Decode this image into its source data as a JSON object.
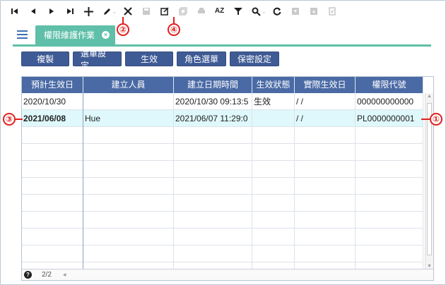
{
  "toolbar": {
    "icons": [
      "first-page-icon",
      "prev-icon",
      "next-icon",
      "last-page-icon",
      "add-icon",
      "edit-icon",
      "cancel-icon",
      "save-icon",
      "open-external-icon",
      "copy-icon",
      "print-icon",
      "sort-az-icon",
      "filter-icon",
      "search-icon",
      "refresh-icon",
      "download-icon",
      "upload-icon",
      "checklist-icon"
    ],
    "sort_label": "AZ"
  },
  "tab": {
    "label": "權限維護作業"
  },
  "actions": [
    "複製",
    "選單設定",
    "生效",
    "角色選單",
    "保密設定"
  ],
  "grid": {
    "columns": [
      "預計生效日",
      "建立人員",
      "建立日期時間",
      "生效狀態",
      "實際生效日",
      "權限代號"
    ],
    "rows": [
      [
        "2020/10/30",
        "",
        "2020/10/30 09:13:5",
        "生效",
        "/ /",
        "000000000000"
      ],
      [
        "2021/06/08",
        "Hue",
        "2021/06/07 11:29:0",
        "",
        "/ /",
        "PL0000000001"
      ]
    ],
    "selected_row": 1
  },
  "footer": {
    "pager": "2/2",
    "help": "?"
  },
  "annotations": [
    "①",
    "②",
    "③",
    "④"
  ],
  "colors": {
    "header_bg": "#4a6aa5",
    "tab_bg": "#5fbfa8",
    "button_bg": "#3f5b95",
    "selected_row": "#dff8fb",
    "annotation": "#e02020"
  }
}
